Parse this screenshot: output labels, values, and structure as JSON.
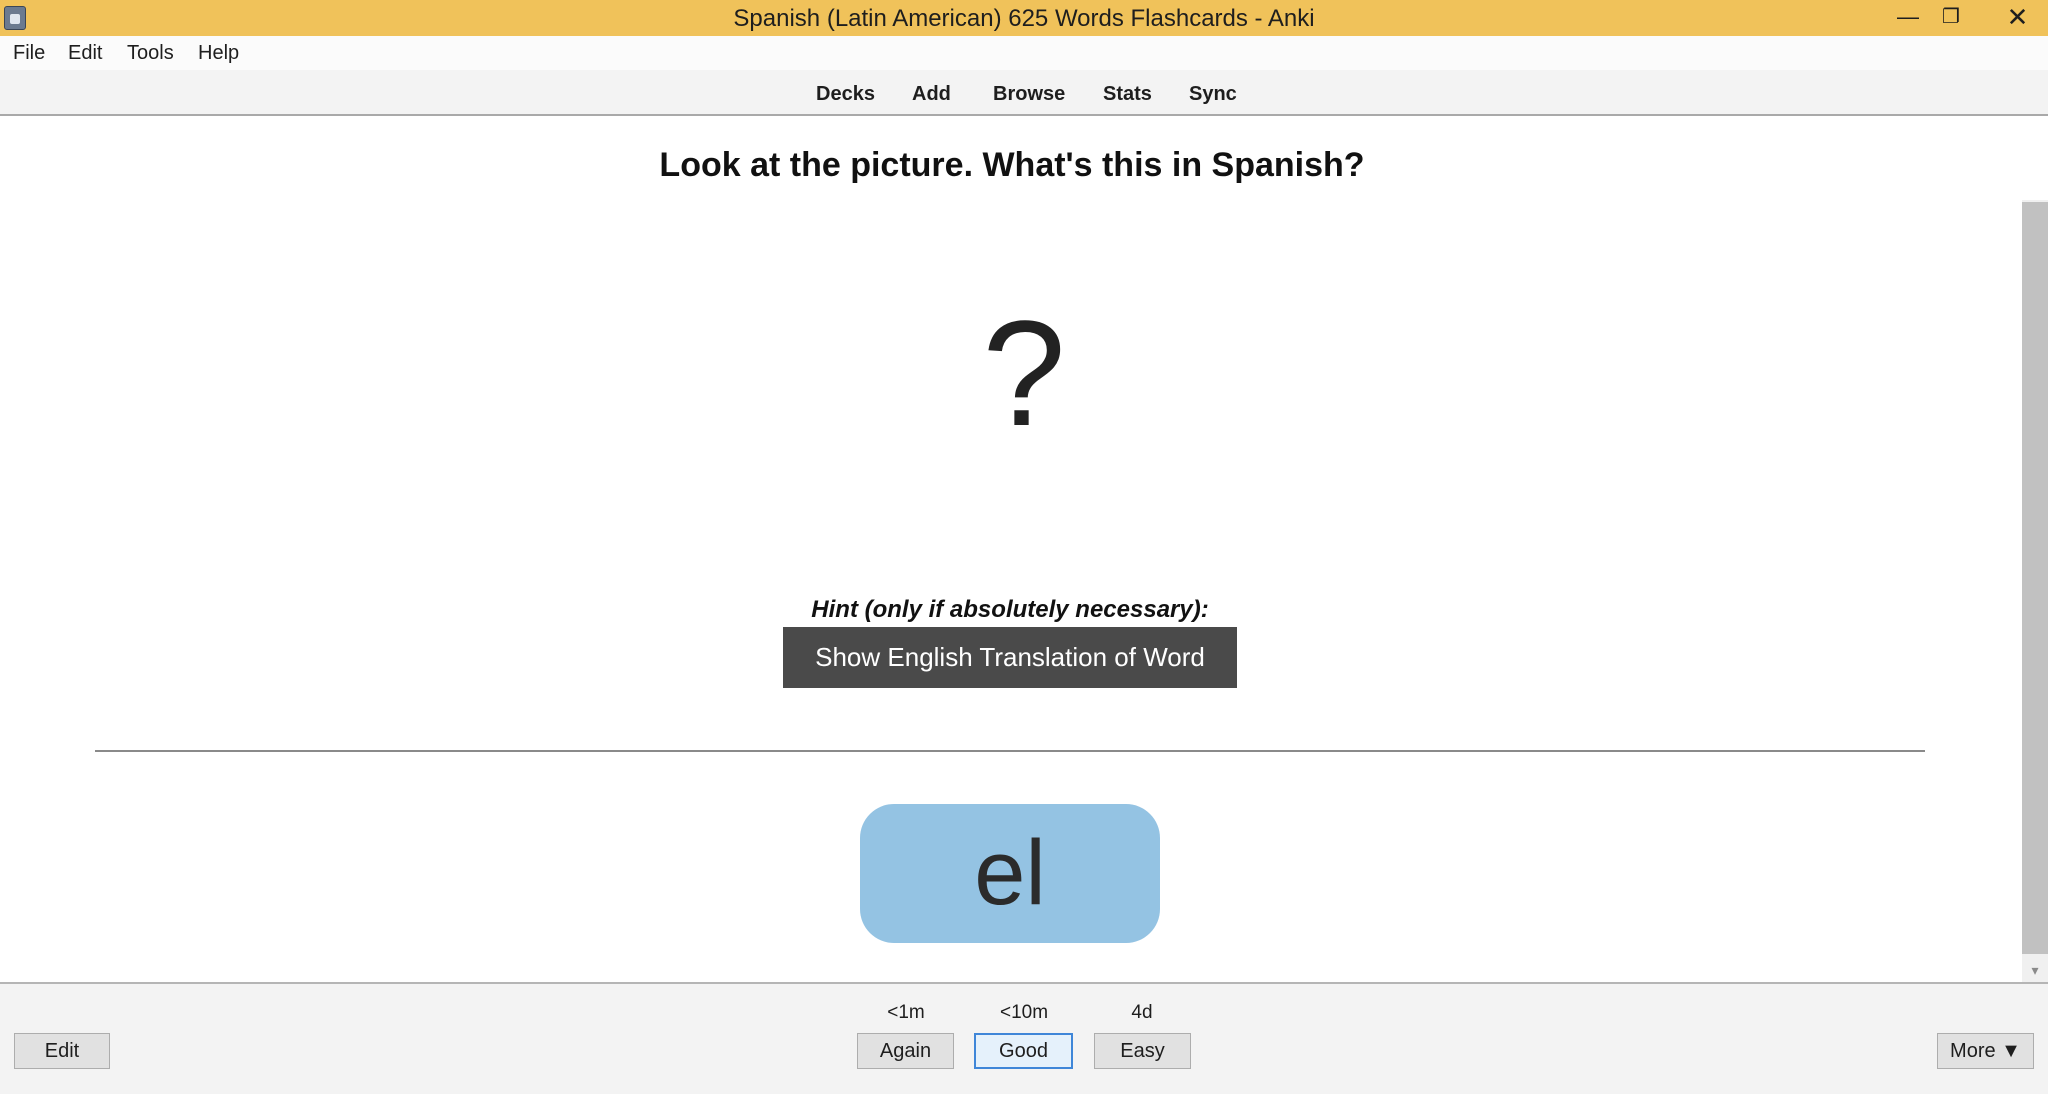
{
  "window": {
    "title": "Spanish (Latin American) 625 Words Flashcards - Anki",
    "minimize": "—",
    "maximize": "❐",
    "close": "✕"
  },
  "menu": {
    "file": "File",
    "edit": "Edit",
    "tools": "Tools",
    "help": "Help"
  },
  "toolbar": {
    "decks": "Decks",
    "add": "Add",
    "browse": "Browse",
    "stats": "Stats",
    "sync": "Sync"
  },
  "card": {
    "question": "Look at the picture. What's this in Spanish?",
    "image_placeholder": "?",
    "hint_label": "Hint (only if absolutely necessary):",
    "hint_button": "Show English Translation of Word",
    "answer": "el",
    "answer_color": "#94c3e3"
  },
  "scrollbar": {
    "down_arrow": "▾"
  },
  "bottom": {
    "edit": "Edit",
    "more": "More ▼",
    "answers": [
      {
        "interval": "<1m",
        "label": "Again"
      },
      {
        "interval": "<10m",
        "label": "Good"
      },
      {
        "interval": "4d",
        "label": "Easy"
      }
    ]
  },
  "colors": {
    "titlebar": "#f0c25a",
    "hint_button_bg": "#4a4a4a",
    "default_button_border": "#3f86d8"
  }
}
